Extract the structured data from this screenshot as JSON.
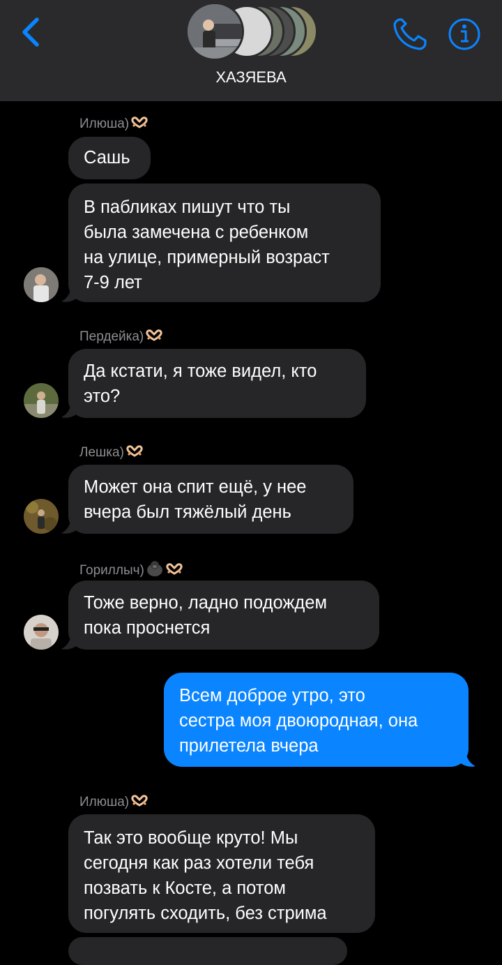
{
  "header": {
    "group_name": "ХАЗЯЕВА",
    "back_icon": "chevron-left-icon",
    "call_icon": "phone-icon",
    "info_icon": "info-icon",
    "accent_color": "#0a84ff",
    "background_color": "#2a2a2c"
  },
  "messages": [
    {
      "sender": "Илюша)",
      "sender_emoji": "heart-hands",
      "lines": [
        "Сашь"
      ]
    },
    {
      "lines": [
        "В пабликах пишут что ты",
        "была замечена с ребенком",
        "на улице, примерный возраст",
        "7-9 лет"
      ]
    },
    {
      "sender": "Пердейка)",
      "sender_emoji": "heart-hands",
      "lines": [
        "Да кстати, я тоже видел, кто",
        "это?"
      ]
    },
    {
      "sender": "Лешка)",
      "sender_emoji": "heart-hands",
      "lines": [
        "Может она спит ещё, у нее",
        "вчера был тяжёлый день"
      ]
    },
    {
      "sender": "Гориллыч)",
      "sender_emoji": "gorilla, heart-hands",
      "lines": [
        "Тоже верно, ладно подождем",
        "пока проснется"
      ]
    },
    {
      "outgoing": true,
      "lines": [
        "Всем доброе утро,  это",
        "сестра моя двоюродная, она",
        "прилетела вчера"
      ]
    },
    {
      "sender": "Илюша)",
      "sender_emoji": "heart-hands",
      "lines": [
        "Так это вообще круто! Мы",
        "сегодня как раз хотели тебя",
        "позвать к Косте, а потом",
        "погулять сходить, без стрима"
      ]
    }
  ],
  "colors": {
    "incoming_bubble": "#262628",
    "outgoing_bubble": "#0a84ff",
    "sender_name": "#8e8e93",
    "background": "#000000"
  }
}
